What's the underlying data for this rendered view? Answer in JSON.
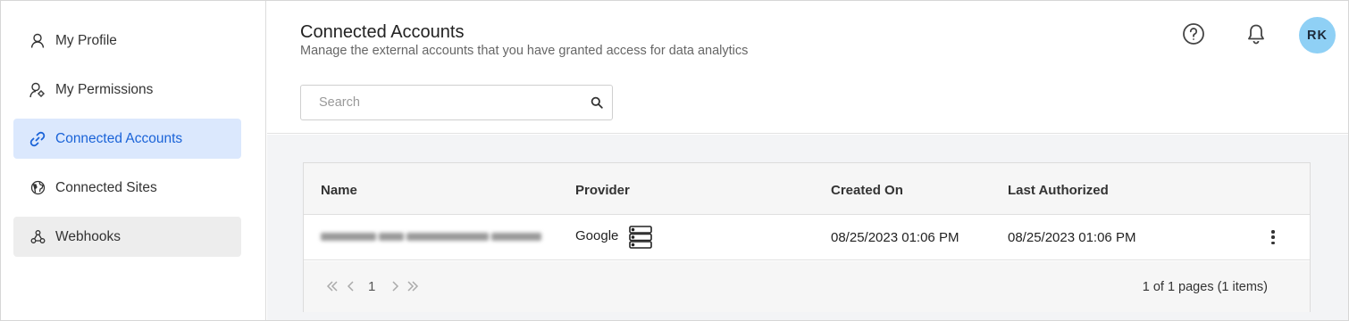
{
  "sidebar": {
    "items": [
      {
        "label": "My Profile",
        "icon": "user-icon",
        "state": "default"
      },
      {
        "label": "My Permissions",
        "icon": "user-gear-icon",
        "state": "default"
      },
      {
        "label": "Connected Accounts",
        "icon": "link-icon",
        "state": "active"
      },
      {
        "label": "Connected Sites",
        "icon": "globe-icon",
        "state": "default"
      },
      {
        "label": "Webhooks",
        "icon": "webhook-icon",
        "state": "hover"
      }
    ]
  },
  "header": {
    "title": "Connected Accounts",
    "subtitle": "Manage the external accounts that you have granted access for data analytics",
    "avatar_initials": "RK"
  },
  "search": {
    "placeholder": "Search",
    "value": ""
  },
  "grid": {
    "columns": [
      "Name",
      "Provider",
      "Created On",
      "Last Authorized"
    ],
    "rows": [
      {
        "name": "",
        "provider": "Google",
        "created_on": "08/25/2023 01:06 PM",
        "last_authorized": "08/25/2023 01:06 PM"
      }
    ],
    "pager": {
      "current_page": "1",
      "info": "1 of 1 pages (1 items)"
    }
  },
  "colors": {
    "accent": "#1a63d8",
    "active_bg": "#dbe8fd",
    "hover_bg": "#ededed",
    "avatar_bg": "#8fd0f5",
    "content_bg": "#f3f4f6"
  }
}
